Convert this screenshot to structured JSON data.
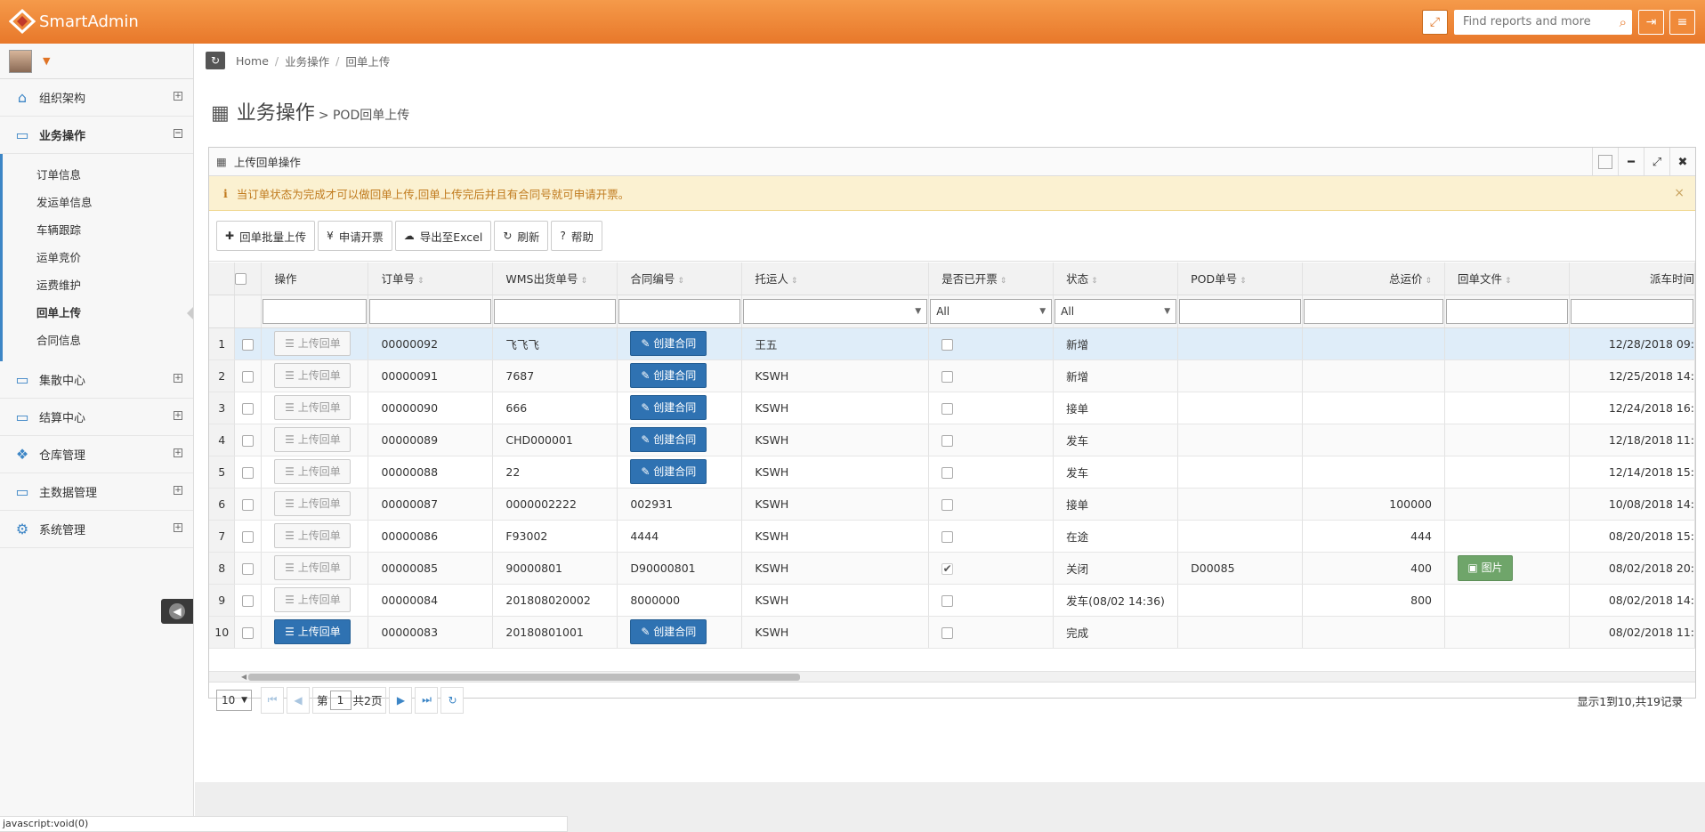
{
  "app": {
    "title": "SmartAdmin"
  },
  "header": {
    "search_placeholder": "Find reports and more",
    "icons": [
      "fullscreen-icon",
      "search-icon",
      "logout-icon",
      "menu-icon"
    ]
  },
  "sidebar": {
    "items": [
      {
        "label": "组织架构",
        "icon": "home-icon",
        "toggle": "⊞"
      },
      {
        "label": "业务操作",
        "icon": "folder-icon",
        "toggle": "⊟",
        "active": true
      },
      {
        "label": "集散中心",
        "icon": "folder-icon",
        "toggle": "⊞"
      },
      {
        "label": "结算中心",
        "icon": "folder-icon",
        "toggle": "⊞"
      },
      {
        "label": "仓库管理",
        "icon": "cubes-icon",
        "toggle": "⊞"
      },
      {
        "label": "主数据管理",
        "icon": "folder-icon",
        "toggle": "⊞"
      },
      {
        "label": "系统管理",
        "icon": "cogs-icon",
        "toggle": "⊞"
      }
    ],
    "subitems": [
      "订单信息",
      "发运单信息",
      "车辆跟踪",
      "运单竞价",
      "运费维护",
      "回单上传",
      "合同信息"
    ],
    "current_sub": "回单上传"
  },
  "breadcrumb": [
    "Home",
    "业务操作",
    "回单上传"
  ],
  "page": {
    "title": "业务操作",
    "subtitle": "> POD回单上传"
  },
  "widget": {
    "title": "上传回单操作",
    "alert": "当订单状态为完成才可以做回单上传,回单上传完后并且有合同号就可申请开票。",
    "toolbar": [
      {
        "icon": "plus-icon",
        "label": "回单批量上传"
      },
      {
        "icon": "yen-icon",
        "label": "申请开票"
      },
      {
        "icon": "cloud-download-icon",
        "label": "导出至Excel"
      },
      {
        "icon": "refresh-icon",
        "label": "刷新"
      },
      {
        "icon": "question-icon",
        "label": "帮助"
      }
    ]
  },
  "grid": {
    "columns": [
      "操作",
      "订单号",
      "WMS出货单号",
      "合同编号",
      "托运人",
      "是否已开票",
      "状态",
      "POD单号",
      "总运价",
      "回单文件",
      "派车时间"
    ],
    "filter_selects": {
      "invoiced": "All",
      "status": "All"
    },
    "upload_label": "上传回单",
    "contract_label": "创建合同",
    "picture_label": "图片",
    "rows": [
      {
        "n": "1",
        "order": "00000092",
        "wms": "飞飞飞",
        "contract": "",
        "shipper": "王五",
        "invoiced": false,
        "status": "新增",
        "pod": "",
        "price": "",
        "file": false,
        "dispatch": "12/28/2018 09:",
        "create_btn": true,
        "upload_active": false
      },
      {
        "n": "2",
        "order": "00000091",
        "wms": "7687",
        "contract": "",
        "shipper": "KSWH",
        "invoiced": false,
        "status": "新增",
        "pod": "",
        "price": "",
        "file": false,
        "dispatch": "12/25/2018 14:",
        "create_btn": true,
        "upload_active": false
      },
      {
        "n": "3",
        "order": "00000090",
        "wms": "666",
        "contract": "",
        "shipper": "KSWH",
        "invoiced": false,
        "status": "接单",
        "pod": "",
        "price": "",
        "file": false,
        "dispatch": "12/24/2018 16:",
        "create_btn": true,
        "upload_active": false
      },
      {
        "n": "4",
        "order": "00000089",
        "wms": "CHD000001",
        "contract": "",
        "shipper": "KSWH",
        "invoiced": false,
        "status": "发车",
        "pod": "",
        "price": "",
        "file": false,
        "dispatch": "12/18/2018 11:",
        "create_btn": true,
        "upload_active": false
      },
      {
        "n": "5",
        "order": "00000088",
        "wms": "22",
        "contract": "",
        "shipper": "KSWH",
        "invoiced": false,
        "status": "发车",
        "pod": "",
        "price": "",
        "file": false,
        "dispatch": "12/14/2018 15:",
        "create_btn": true,
        "upload_active": false
      },
      {
        "n": "6",
        "order": "00000087",
        "wms": "0000002222",
        "contract": "002931",
        "shipper": "KSWH",
        "invoiced": false,
        "status": "接单",
        "pod": "",
        "price": "100000",
        "file": false,
        "dispatch": "10/08/2018 14:",
        "create_btn": false,
        "upload_active": false
      },
      {
        "n": "7",
        "order": "00000086",
        "wms": "F93002",
        "contract": "4444",
        "shipper": "KSWH",
        "invoiced": false,
        "status": "在途",
        "pod": "",
        "price": "444",
        "file": false,
        "dispatch": "08/20/2018 15:",
        "create_btn": false,
        "upload_active": false
      },
      {
        "n": "8",
        "order": "00000085",
        "wms": "90000801",
        "contract": "D90000801",
        "shipper": "KSWH",
        "invoiced": true,
        "status": "关闭",
        "pod": "D00085",
        "price": "400",
        "file": true,
        "dispatch": "08/02/2018 20:",
        "create_btn": false,
        "upload_active": false
      },
      {
        "n": "9",
        "order": "00000084",
        "wms": "201808020002",
        "contract": "8000000",
        "shipper": "KSWH",
        "invoiced": false,
        "status": "发车(08/02 14:36)",
        "pod": "",
        "price": "800",
        "file": false,
        "dispatch": "08/02/2018 14:",
        "create_btn": false,
        "upload_active": false
      },
      {
        "n": "10",
        "order": "00000083",
        "wms": "20180801001",
        "contract": "",
        "shipper": "KSWH",
        "invoiced": false,
        "status": "完成",
        "pod": "",
        "price": "",
        "file": false,
        "dispatch": "08/02/2018 11:",
        "create_btn": true,
        "upload_active": true
      }
    ]
  },
  "pager": {
    "page_size": "10",
    "page_label_pre": "第",
    "page": "1",
    "page_label_post": "共2页",
    "info": "显示1到10,共19记录"
  },
  "statusbar": "javascript:void(0)"
}
